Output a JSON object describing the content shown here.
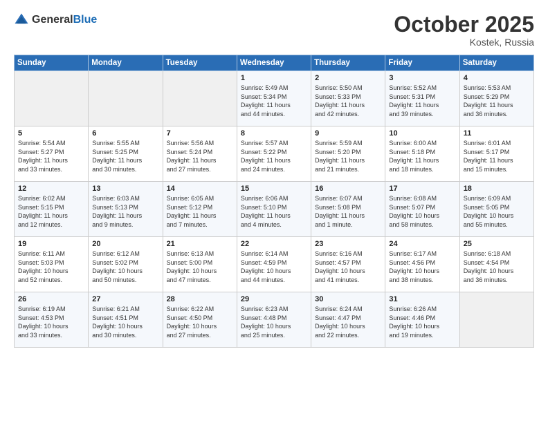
{
  "header": {
    "logo_general": "General",
    "logo_blue": "Blue",
    "month": "October 2025",
    "location": "Kostek, Russia"
  },
  "days_of_week": [
    "Sunday",
    "Monday",
    "Tuesday",
    "Wednesday",
    "Thursday",
    "Friday",
    "Saturday"
  ],
  "weeks": [
    [
      {
        "day": "",
        "info": ""
      },
      {
        "day": "",
        "info": ""
      },
      {
        "day": "",
        "info": ""
      },
      {
        "day": "1",
        "info": "Sunrise: 5:49 AM\nSunset: 5:34 PM\nDaylight: 11 hours\nand 44 minutes."
      },
      {
        "day": "2",
        "info": "Sunrise: 5:50 AM\nSunset: 5:33 PM\nDaylight: 11 hours\nand 42 minutes."
      },
      {
        "day": "3",
        "info": "Sunrise: 5:52 AM\nSunset: 5:31 PM\nDaylight: 11 hours\nand 39 minutes."
      },
      {
        "day": "4",
        "info": "Sunrise: 5:53 AM\nSunset: 5:29 PM\nDaylight: 11 hours\nand 36 minutes."
      }
    ],
    [
      {
        "day": "5",
        "info": "Sunrise: 5:54 AM\nSunset: 5:27 PM\nDaylight: 11 hours\nand 33 minutes."
      },
      {
        "day": "6",
        "info": "Sunrise: 5:55 AM\nSunset: 5:25 PM\nDaylight: 11 hours\nand 30 minutes."
      },
      {
        "day": "7",
        "info": "Sunrise: 5:56 AM\nSunset: 5:24 PM\nDaylight: 11 hours\nand 27 minutes."
      },
      {
        "day": "8",
        "info": "Sunrise: 5:57 AM\nSunset: 5:22 PM\nDaylight: 11 hours\nand 24 minutes."
      },
      {
        "day": "9",
        "info": "Sunrise: 5:59 AM\nSunset: 5:20 PM\nDaylight: 11 hours\nand 21 minutes."
      },
      {
        "day": "10",
        "info": "Sunrise: 6:00 AM\nSunset: 5:18 PM\nDaylight: 11 hours\nand 18 minutes."
      },
      {
        "day": "11",
        "info": "Sunrise: 6:01 AM\nSunset: 5:17 PM\nDaylight: 11 hours\nand 15 minutes."
      }
    ],
    [
      {
        "day": "12",
        "info": "Sunrise: 6:02 AM\nSunset: 5:15 PM\nDaylight: 11 hours\nand 12 minutes."
      },
      {
        "day": "13",
        "info": "Sunrise: 6:03 AM\nSunset: 5:13 PM\nDaylight: 11 hours\nand 9 minutes."
      },
      {
        "day": "14",
        "info": "Sunrise: 6:05 AM\nSunset: 5:12 PM\nDaylight: 11 hours\nand 7 minutes."
      },
      {
        "day": "15",
        "info": "Sunrise: 6:06 AM\nSunset: 5:10 PM\nDaylight: 11 hours\nand 4 minutes."
      },
      {
        "day": "16",
        "info": "Sunrise: 6:07 AM\nSunset: 5:08 PM\nDaylight: 11 hours\nand 1 minute."
      },
      {
        "day": "17",
        "info": "Sunrise: 6:08 AM\nSunset: 5:07 PM\nDaylight: 10 hours\nand 58 minutes."
      },
      {
        "day": "18",
        "info": "Sunrise: 6:09 AM\nSunset: 5:05 PM\nDaylight: 10 hours\nand 55 minutes."
      }
    ],
    [
      {
        "day": "19",
        "info": "Sunrise: 6:11 AM\nSunset: 5:03 PM\nDaylight: 10 hours\nand 52 minutes."
      },
      {
        "day": "20",
        "info": "Sunrise: 6:12 AM\nSunset: 5:02 PM\nDaylight: 10 hours\nand 50 minutes."
      },
      {
        "day": "21",
        "info": "Sunrise: 6:13 AM\nSunset: 5:00 PM\nDaylight: 10 hours\nand 47 minutes."
      },
      {
        "day": "22",
        "info": "Sunrise: 6:14 AM\nSunset: 4:59 PM\nDaylight: 10 hours\nand 44 minutes."
      },
      {
        "day": "23",
        "info": "Sunrise: 6:16 AM\nSunset: 4:57 PM\nDaylight: 10 hours\nand 41 minutes."
      },
      {
        "day": "24",
        "info": "Sunrise: 6:17 AM\nSunset: 4:56 PM\nDaylight: 10 hours\nand 38 minutes."
      },
      {
        "day": "25",
        "info": "Sunrise: 6:18 AM\nSunset: 4:54 PM\nDaylight: 10 hours\nand 36 minutes."
      }
    ],
    [
      {
        "day": "26",
        "info": "Sunrise: 6:19 AM\nSunset: 4:53 PM\nDaylight: 10 hours\nand 33 minutes."
      },
      {
        "day": "27",
        "info": "Sunrise: 6:21 AM\nSunset: 4:51 PM\nDaylight: 10 hours\nand 30 minutes."
      },
      {
        "day": "28",
        "info": "Sunrise: 6:22 AM\nSunset: 4:50 PM\nDaylight: 10 hours\nand 27 minutes."
      },
      {
        "day": "29",
        "info": "Sunrise: 6:23 AM\nSunset: 4:48 PM\nDaylight: 10 hours\nand 25 minutes."
      },
      {
        "day": "30",
        "info": "Sunrise: 6:24 AM\nSunset: 4:47 PM\nDaylight: 10 hours\nand 22 minutes."
      },
      {
        "day": "31",
        "info": "Sunrise: 6:26 AM\nSunset: 4:46 PM\nDaylight: 10 hours\nand 19 minutes."
      },
      {
        "day": "",
        "info": ""
      }
    ]
  ]
}
